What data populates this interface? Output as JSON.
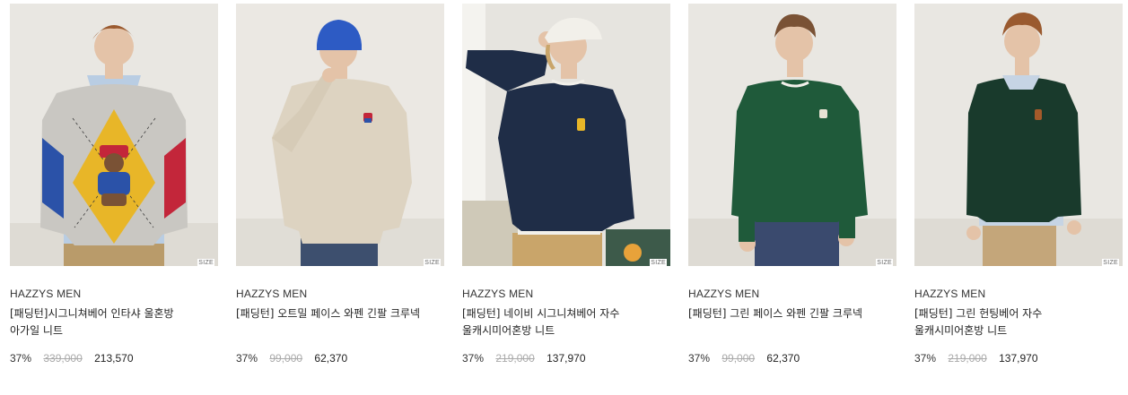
{
  "products": [
    {
      "brand": "HAZZYS MEN",
      "title": "[패딩턴]시그니쳐베어 인타샤 울혼방 아가일 니트",
      "discount": "37%",
      "original_price": "339,000",
      "sale_price": "213,570",
      "size_label": "SIZE",
      "image_alt": "Model wearing grey argyle knit with bear intarsia",
      "colors": {
        "bg": "#e9e7e2",
        "garment": "#c9c7c2",
        "accent": "#e8b628"
      }
    },
    {
      "brand": "HAZZYS MEN",
      "title": "[패딩턴] 오트밀 페이스 와펜 긴팔 크루넥",
      "discount": "37%",
      "original_price": "99,000",
      "sale_price": "62,370",
      "size_label": "SIZE",
      "image_alt": "Model wearing oatmeal crewneck with blue beanie",
      "colors": {
        "bg": "#ebe8e3",
        "garment": "#ddd3c1",
        "accent": "#2d5bc4"
      }
    },
    {
      "brand": "HAZZYS MEN",
      "title": "[패딩턴] 네이비 시그니쳐베어 자수 울캐시미어혼방 니트",
      "discount": "37%",
      "original_price": "219,000",
      "sale_price": "137,970",
      "size_label": "SIZE",
      "image_alt": "Model wearing navy knit with white cap",
      "colors": {
        "bg": "#e6e4df",
        "garment": "#1f2d47",
        "accent": "#f2f0ea"
      }
    },
    {
      "brand": "HAZZYS MEN",
      "title": "[패딩턴] 그린 페이스 와펜 긴팔 크루넥",
      "discount": "37%",
      "original_price": "99,000",
      "sale_price": "62,370",
      "size_label": "SIZE",
      "image_alt": "Model wearing green crewneck",
      "colors": {
        "bg": "#e9e7e2",
        "garment": "#1f5a3a",
        "accent": "#3a4a6e"
      }
    },
    {
      "brand": "HAZZYS MEN",
      "title": "[패딩턴] 그린 헌팅베어 자수 울캐시미어혼방 니트",
      "discount": "37%",
      "original_price": "219,000",
      "sale_price": "137,970",
      "size_label": "SIZE",
      "image_alt": "Model wearing dark green knit with beige trousers",
      "colors": {
        "bg": "#e9e7e2",
        "garment": "#193a2c",
        "accent": "#c4a67a"
      }
    }
  ]
}
